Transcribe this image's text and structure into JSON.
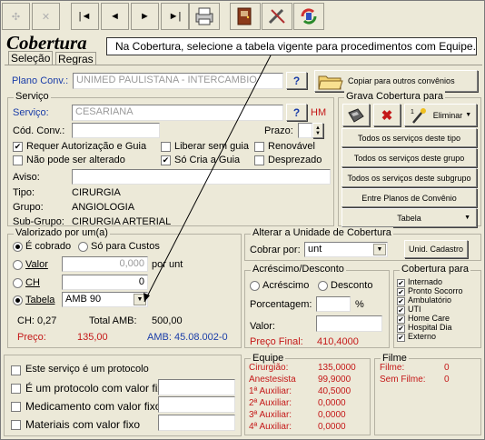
{
  "toolbar": {
    "nav_first": "|◄",
    "nav_prev": "◄",
    "nav_next": "►",
    "nav_last": "►|"
  },
  "title": "Cobertura",
  "tooltip": "Na Cobertura, selecione a tabela vigente para procedimentos com Equipe.",
  "tabs": [
    "Seleção",
    "Regras"
  ],
  "plano": {
    "label": "Plano Conv.:",
    "value": "UNIMED PAULISTANA - INTERCAMBIO",
    "copy_label": "Copiar para outros convênios",
    "help": "?"
  },
  "servico": {
    "group_label": "Serviço",
    "servico_label": "Serviço:",
    "servico_value": "CESARIANA",
    "help": "?",
    "hm": "HM",
    "cod_label": "Cód. Conv.:",
    "prazo_label": "Prazo:",
    "checks": [
      {
        "label": "Requer Autorização e Guia",
        "checked": true
      },
      {
        "label": "Liberar sem guia",
        "checked": false
      },
      {
        "label": "Renovável",
        "checked": false
      },
      {
        "label": "Não pode ser alterado",
        "checked": false
      },
      {
        "label": "Só Cria a Guia",
        "checked": true
      },
      {
        "label": "Desprezado",
        "checked": false
      }
    ],
    "aviso_label": "Aviso:",
    "tipo_label": "Tipo:",
    "tipo_value": "CIRURGIA",
    "grupo_label": "Grupo:",
    "grupo_value": "ANGIOLOGIA",
    "subgrupo_label": "Sub-Grupo:",
    "subgrupo_value": "CIRURGIA ARTERIAL"
  },
  "grava": {
    "group_label": "Grava Cobertura para",
    "eliminar": "Eliminar",
    "buttons": [
      "Todos os serviços deste tipo",
      "Todos os serviços deste grupo",
      "Todos os serviços deste subgrupo",
      "Entre Planos de Convênio",
      "Tabela"
    ]
  },
  "valorizado": {
    "group_label": "Valorizado por um(a)",
    "cobrado": "É cobrado",
    "so_custos": "Só para Custos",
    "valor_label": "Valor",
    "valor_value": "0,000",
    "por_unt": "por unt",
    "ch_label": "CH",
    "ch_value": "0",
    "tabela_label": "Tabela",
    "tabela_value": "AMB 90",
    "ch_info": "CH:  0,27",
    "total_amb_label": "Total AMB:",
    "total_amb_value": "500,00",
    "preco_label": "Preço:",
    "preco_value": "135,00",
    "amb_value": "AMB: 45.08.002-0"
  },
  "unidade": {
    "group_label": "Alterar a Unidade de Cobertura",
    "cobrar_label": "Cobrar por:",
    "cobrar_value": "unt",
    "cadastro": "Unid. Cadastro"
  },
  "acrescimo": {
    "group_label": "Acréscimo/Desconto",
    "acrescimo": "Acréscimo",
    "desconto": "Desconto",
    "porcentagem_label": "Porcentagem:",
    "pct": "%",
    "valor_label": "Valor:",
    "preco_final_label": "Preço Final:",
    "preco_final_value": "410,4000"
  },
  "cobertura_para": {
    "group_label": "Cobertura para",
    "items": [
      "Internado",
      "Pronto Socorro",
      "Ambulatório",
      "UTI",
      "Home Care",
      "Hospital Dia",
      "Externo"
    ]
  },
  "bottom_checks": [
    "Este serviço é um protocolo",
    "É um protocolo com valor fixo",
    "Medicamento com valor fixo",
    "Materiais com valor fixo"
  ],
  "equipe": {
    "group_label": "Equipe",
    "rows": [
      {
        "label": "Cirurgião:",
        "value": "135,0000"
      },
      {
        "label": "Anestesista",
        "value": "99,9000"
      },
      {
        "label": "1ª Auxiliar:",
        "value": "40,5000"
      },
      {
        "label": "2ª Auxiliar:",
        "value": "0,0000"
      },
      {
        "label": "3ª Auxiliar:",
        "value": "0,0000"
      },
      {
        "label": "4ª Auxiliar:",
        "value": "0,0000"
      }
    ]
  },
  "filme": {
    "group_label": "Filme",
    "filme_label": "Filme:",
    "filme_value": "0",
    "sem_filme_label": "Sem Filme:",
    "sem_filme_value": "0"
  },
  "colors": {
    "accent_blue": "#1a3da8",
    "red": "#c41818"
  }
}
